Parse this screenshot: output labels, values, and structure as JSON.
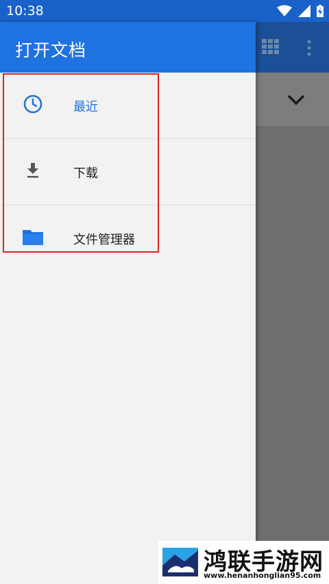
{
  "status_bar": {
    "time": "10:38",
    "icons": [
      "wifi-icon",
      "signal-icon",
      "battery-charging-icon"
    ]
  },
  "background_app": {
    "toolbar_actions": [
      "grid-view-icon",
      "more-vert-icon"
    ],
    "sort_control_icon": "chevron-down-icon"
  },
  "drawer": {
    "title": "打开文档",
    "roots": [
      {
        "label": "最近",
        "icon": "clock-icon",
        "active": true
      },
      {
        "label": "下载",
        "icon": "download-icon",
        "active": false
      },
      {
        "label": "文件管理器",
        "icon": "folder-icon",
        "active": false
      }
    ]
  },
  "watermark": {
    "title": "鸿联手游网",
    "url": "www.henanhonglian95.com"
  },
  "colors": {
    "accent": "#1f73e0",
    "status_bar": "#1a62c8",
    "highlight": "#e02020",
    "folder": "#1f73e0"
  }
}
